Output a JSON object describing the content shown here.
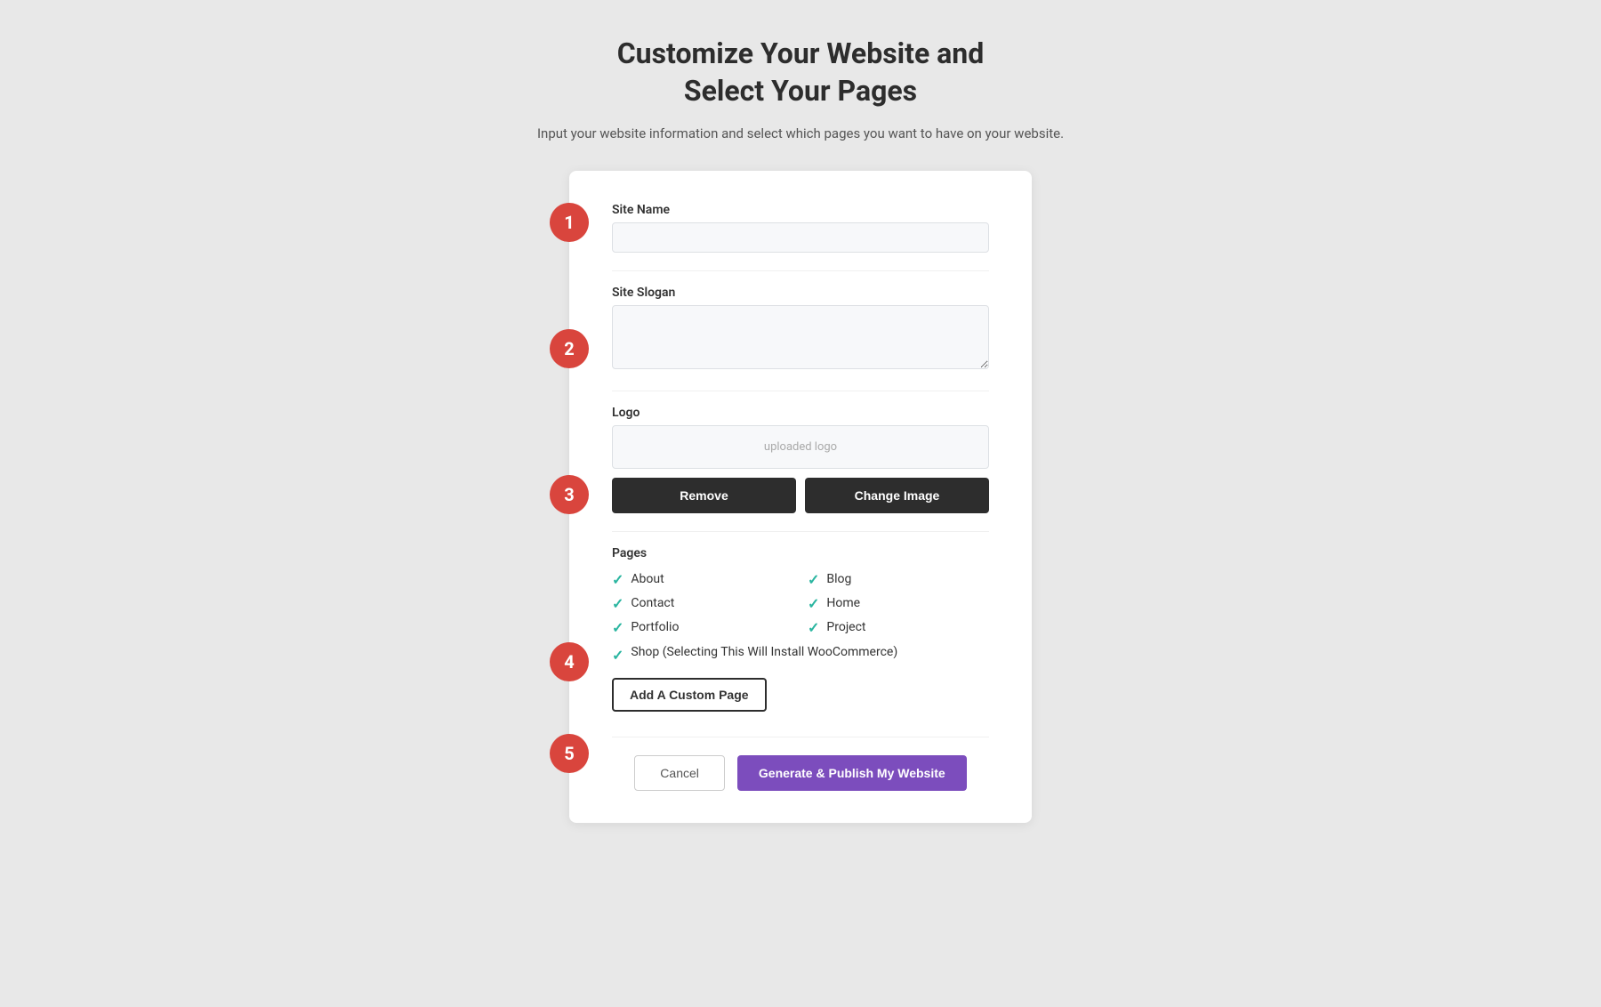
{
  "header": {
    "title_line1": "Customize Your Website and",
    "title_line2": "Select Your Pages",
    "subtitle": "Input your website information and select which pages you want to have on your website."
  },
  "form": {
    "site_name_label": "Site Name",
    "site_name_placeholder": "",
    "site_slogan_label": "Site Slogan",
    "site_slogan_placeholder": "",
    "logo_label": "Logo",
    "logo_placeholder_text": "uploaded logo",
    "remove_button": "Remove",
    "change_image_button": "Change Image",
    "pages_label": "Pages",
    "pages": [
      {
        "name": "About",
        "checked": true
      },
      {
        "name": "Blog",
        "checked": true
      },
      {
        "name": "Contact",
        "checked": true
      },
      {
        "name": "Home",
        "checked": true
      },
      {
        "name": "Portfolio",
        "checked": true
      },
      {
        "name": "Project",
        "checked": true
      }
    ],
    "shop_page": {
      "name": "Shop (Selecting This Will Install WooCommerce)",
      "checked": true
    },
    "add_custom_page_button": "Add A Custom Page",
    "cancel_button": "Cancel",
    "publish_button": "Generate & Publish My Website"
  },
  "steps": {
    "step1": "1",
    "step2": "2",
    "step3": "3",
    "step4": "4",
    "step5": "5"
  },
  "icons": {
    "check": "✓"
  }
}
